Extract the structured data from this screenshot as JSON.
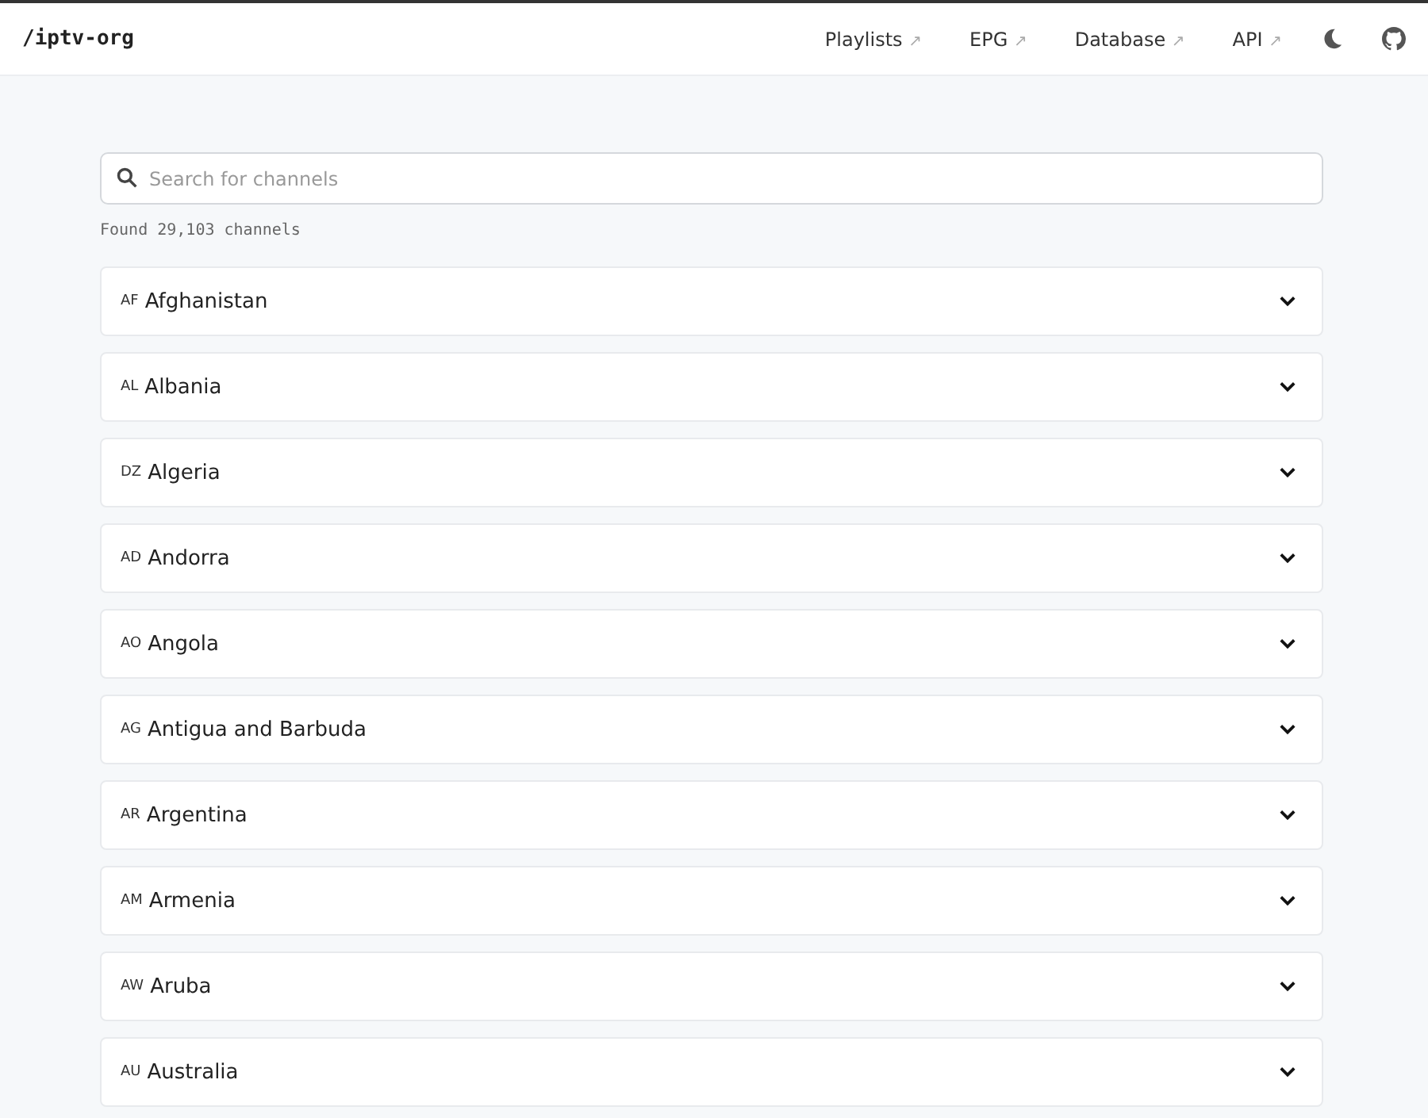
{
  "header": {
    "logo": "/iptv-org",
    "links": [
      {
        "label": "Playlists",
        "arrow": "↗"
      },
      {
        "label": "EPG",
        "arrow": "↗"
      },
      {
        "label": "Database",
        "arrow": "↗"
      },
      {
        "label": "API",
        "arrow": "↗"
      }
    ]
  },
  "search": {
    "placeholder": "Search for channels"
  },
  "found": "Found 29,103 channels",
  "countries": [
    {
      "code": "AF",
      "name": "Afghanistan",
      "expanded": false
    },
    {
      "code": "AL",
      "name": "Albania",
      "expanded": false
    },
    {
      "code": "DZ",
      "name": "Algeria",
      "expanded": false
    },
    {
      "code": "AD",
      "name": "Andorra",
      "expanded": false
    },
    {
      "code": "AO",
      "name": "Angola",
      "expanded": false
    },
    {
      "code": "AG",
      "name": "Antigua and Barbuda",
      "expanded": false
    },
    {
      "code": "AR",
      "name": "Argentina",
      "expanded": false
    },
    {
      "code": "AM",
      "name": "Armenia",
      "expanded": false
    },
    {
      "code": "AW",
      "name": "Aruba",
      "expanded": false
    },
    {
      "code": "AU",
      "name": "Australia",
      "expanded": false
    }
  ]
}
